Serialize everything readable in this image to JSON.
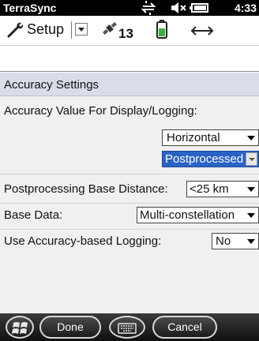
{
  "status_bar": {
    "app_title": "TerraSync",
    "time": "4:33"
  },
  "toolbar": {
    "menu_label": "Setup",
    "satellite_count": "13"
  },
  "section": {
    "title": "Accuracy Settings"
  },
  "form": {
    "accuracy_label": "Accuracy Value For Display/Logging:",
    "accuracy_type_value": "Horizontal",
    "accuracy_mode_value": "Postprocessed",
    "base_distance_label": "Postprocessing Base Distance:",
    "base_distance_value": "<25 km",
    "base_data_label": "Base Data:",
    "base_data_value": "Multi-constellation",
    "accuracy_logging_label": "Use Accuracy-based Logging:",
    "accuracy_logging_value": "No"
  },
  "bottom_bar": {
    "done_label": "Done",
    "cancel_label": "Cancel"
  },
  "colors": {
    "header_band": "#d9dde8",
    "selection": "#2a63c6",
    "status_bar": "#000000"
  }
}
